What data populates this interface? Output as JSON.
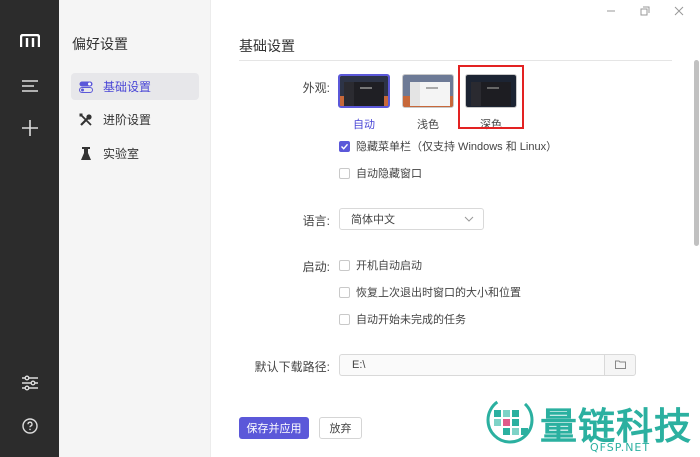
{
  "window": {
    "minimize_icon": "minimize-icon",
    "maximize_icon": "maximize-icon",
    "close_icon": "close-icon"
  },
  "rail": {
    "icons": [
      "logo-icon",
      "menu-icon",
      "add-icon",
      "settings-sliders-icon",
      "help-icon"
    ]
  },
  "prefs": {
    "title": "偏好设置",
    "items": [
      {
        "label": "基础设置",
        "icon": "toggle-icon",
        "active": true
      },
      {
        "label": "进阶设置",
        "icon": "tools-icon",
        "active": false
      },
      {
        "label": "实验室",
        "icon": "flask-icon",
        "active": false
      }
    ]
  },
  "main": {
    "title": "基础设置",
    "appearance": {
      "label": "外观:",
      "themes": [
        {
          "label": "自动",
          "selected": true
        },
        {
          "label": "浅色",
          "selected": false
        },
        {
          "label": "深色",
          "selected": false
        }
      ],
      "hide_menubar": "隐藏菜单栏（仅支持 Windows 和 Linux）",
      "auto_hide_window": "自动隐藏窗口"
    },
    "language": {
      "label": "语言:",
      "value": "简体中文"
    },
    "startup": {
      "label": "启动:",
      "options": [
        "开机自动启动",
        "恢复上次退出时窗口的大小和位置",
        "自动开始未完成的任务"
      ]
    },
    "download_path": {
      "label": "默认下载路径:",
      "value": "E:\\"
    },
    "buttons": {
      "save": "保存并应用",
      "discard": "放弃"
    }
  },
  "watermark": {
    "title": "量链科技",
    "subtitle": "QFSP.NET"
  },
  "colors": {
    "accent": "#5b58d9",
    "rail": "#2c2c2c",
    "highlight": "#e32222",
    "watermark": "#2bb0a0"
  }
}
